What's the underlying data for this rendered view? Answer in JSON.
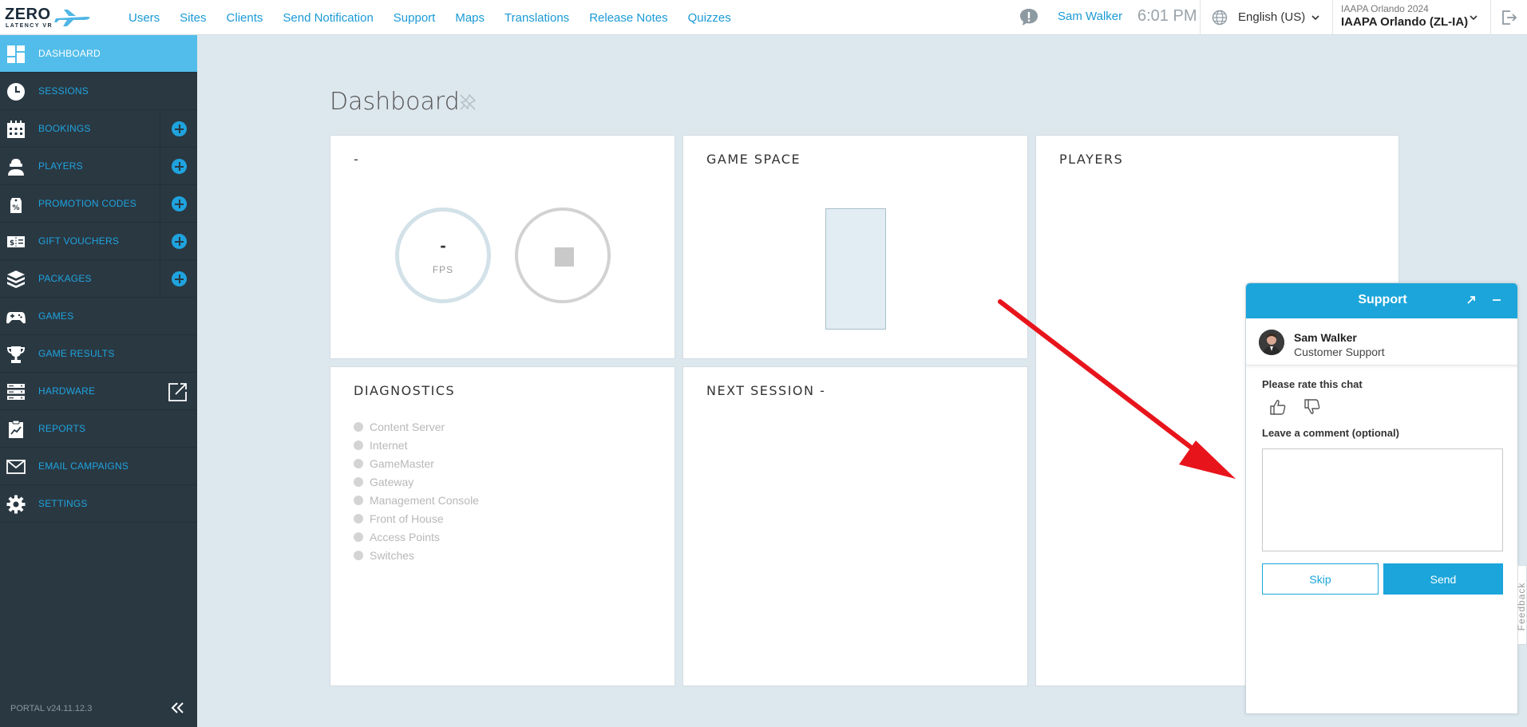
{
  "brand": {
    "logo_top": "ZERO",
    "logo_bottom": "LATENCY VR"
  },
  "top_nav": [
    "Users",
    "Sites",
    "Clients",
    "Send Notification",
    "Support",
    "Maps",
    "Translations",
    "Release Notes",
    "Quizzes"
  ],
  "header": {
    "user": "Sam Walker",
    "time": "6:01 PM",
    "language": "English (US)",
    "site_event": "IAAPA Orlando 2024",
    "site_name": "IAAPA Orlando (ZL-IA)"
  },
  "sidebar": {
    "items": [
      {
        "label": "DASHBOARD",
        "icon": "dashboard-icon",
        "active": true
      },
      {
        "label": "SESSIONS",
        "icon": "clock-icon"
      },
      {
        "label": "BOOKINGS",
        "icon": "calendar-icon",
        "plus": true
      },
      {
        "label": "PLAYERS",
        "icon": "player-icon",
        "plus": true
      },
      {
        "label": "PROMOTION CODES",
        "icon": "tag-percent-icon",
        "plus": true
      },
      {
        "label": "GIFT VOUCHERS",
        "icon": "voucher-icon",
        "plus": true
      },
      {
        "label": "PACKAGES",
        "icon": "packages-icon",
        "plus": true
      },
      {
        "label": "GAMES",
        "icon": "gamepad-icon"
      },
      {
        "label": "GAME RESULTS",
        "icon": "trophy-icon"
      },
      {
        "label": "HARDWARE",
        "icon": "server-icon",
        "external": true
      },
      {
        "label": "REPORTS",
        "icon": "clipboard-chart-icon"
      },
      {
        "label": "EMAIL CAMPAIGNS",
        "icon": "envelope-icon"
      },
      {
        "label": "SETTINGS",
        "icon": "gear-icon"
      }
    ],
    "version": "PORTAL v24.11.12.3"
  },
  "dashboard": {
    "title": "Dashboard",
    "cards": {
      "status_title": "-",
      "fps_value": "-",
      "fps_label": "FPS",
      "game_space_title": "GAME SPACE",
      "players_title": "PLAYERS",
      "diagnostics_title": "DIAGNOSTICS",
      "next_session_title": "NEXT SESSION -"
    },
    "diagnostics": [
      "Content Server",
      "Internet",
      "GameMaster",
      "Gateway",
      "Management Console",
      "Front of House",
      "Access Points",
      "Switches"
    ]
  },
  "support_widget": {
    "title": "Support",
    "agent_name": "Sam Walker",
    "agent_role": "Customer Support",
    "rate_label": "Please rate this chat",
    "comment_label": "Leave a comment (optional)",
    "comment_value": "",
    "skip_label": "Skip",
    "send_label": "Send"
  },
  "feedback_tab": "Feedback",
  "colors": {
    "accent": "#1ba5db",
    "sidebar_bg": "#2a3842",
    "sidebar_active": "#52bdea",
    "page_bg": "#dde7ee",
    "arrow": "#e8141b"
  }
}
